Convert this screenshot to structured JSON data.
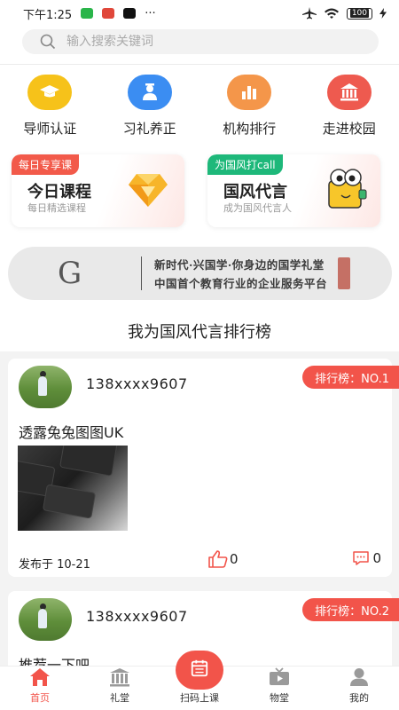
{
  "status_bar": {
    "time": "下午1:25",
    "more": "···",
    "battery": "100"
  },
  "search": {
    "placeholder": "输入搜索关键词"
  },
  "nav": [
    {
      "label": "导师认证",
      "icon": "mortarboard-icon",
      "color": "#f6c21a"
    },
    {
      "label": "习礼养正",
      "icon": "student-icon",
      "color": "#3b8df2"
    },
    {
      "label": "机构排行",
      "icon": "bar-chart-icon",
      "color": "#f4964a"
    },
    {
      "label": "走进校园",
      "icon": "school-building-icon",
      "color": "#ee5a4f"
    }
  ],
  "promos": [
    {
      "tag": "每日专享课",
      "title": "今日课程",
      "subtitle": "每日精选课程",
      "tag_color": "#f25a4a"
    },
    {
      "tag": "为国风打call",
      "title": "国风代言",
      "subtitle": "成为国风代言人",
      "tag_color": "#1eb87a"
    }
  ],
  "banner": {
    "line1": "新时代·兴国学·你身边的国学礼堂",
    "line2": "中国首个教育行业的企业服务平台"
  },
  "section_title": "我为国风代言排行榜",
  "posts": [
    {
      "username": "138xxxx9607",
      "rank": "排行榜：NO.1",
      "text": "透露兔兔图图UK",
      "date": "发布于 10-21",
      "likes": "0",
      "comments": "0"
    },
    {
      "username": "138xxxx9607",
      "rank": "排行榜：NO.2",
      "text": "推荐一下吧。"
    }
  ],
  "tabbar": [
    {
      "label": "首页",
      "icon": "home-icon",
      "active": true
    },
    {
      "label": "礼堂",
      "icon": "temple-icon"
    },
    {
      "label": "扫码上课",
      "icon": "scan-calendar-icon"
    },
    {
      "label": "物堂",
      "icon": "tv-icon"
    },
    {
      "label": "我的",
      "icon": "user-icon"
    }
  ],
  "colors": {
    "accent": "#f2544a",
    "green_tag": "#1eb87a"
  }
}
